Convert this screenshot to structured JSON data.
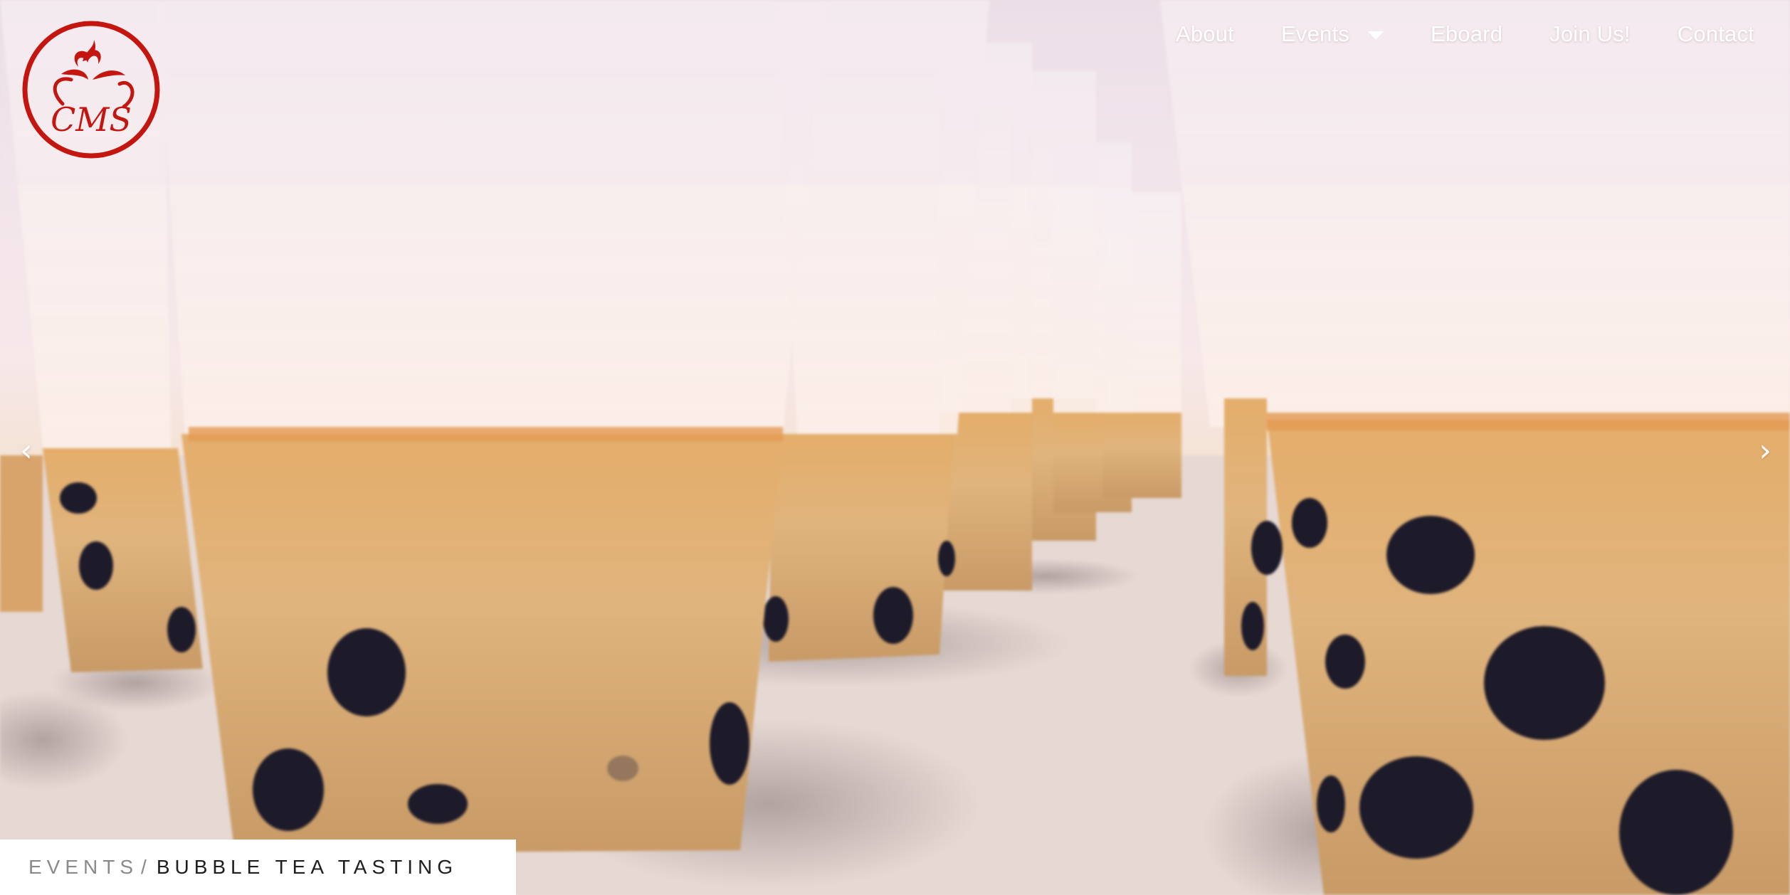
{
  "site": {
    "logo_text": "CMS",
    "logo_color": "#c4160f"
  },
  "nav": {
    "about": "About",
    "events": "Events",
    "eboard": "Eboard",
    "join": "Join Us!",
    "contact": "Contact"
  },
  "slider": {
    "prev_symbol": "‹",
    "next_symbol": "›"
  },
  "breadcrumb": {
    "parent": "EVENTS",
    "separator": "/",
    "current": "BUBBLE TEA TASTING"
  },
  "hero": {
    "subject": "bubble tea cups with tapioca pearls"
  }
}
